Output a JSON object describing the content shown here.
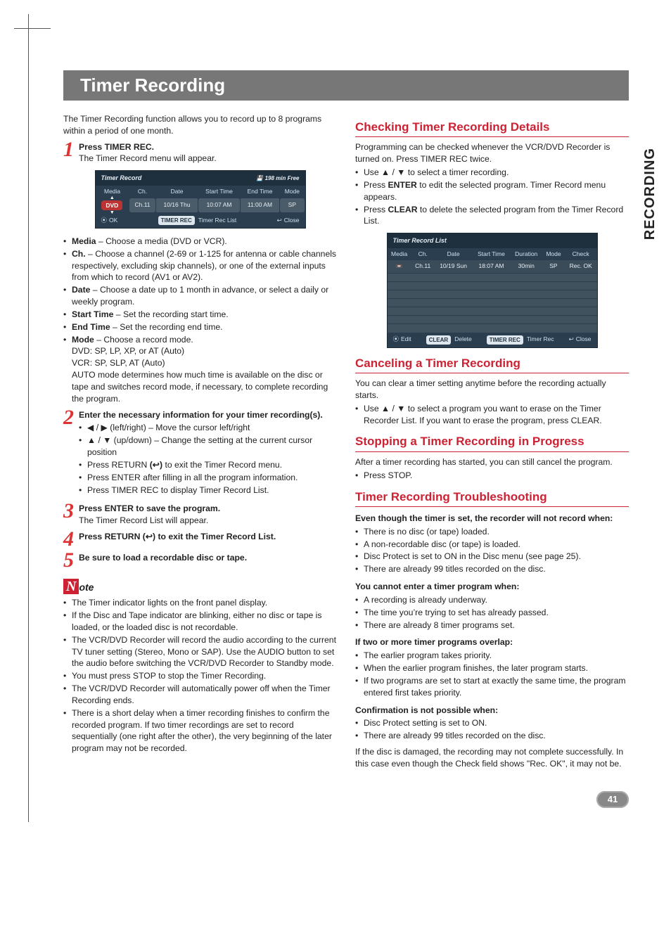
{
  "side_tab": "RECORDING",
  "page_title": "Timer Recording",
  "intro": "The Timer Recording function allows you to record up to 8 programs within a period of one month.",
  "steps": {
    "s1_lead": "Press TIMER REC.",
    "s1_sub": "The Timer Record menu will appear.",
    "s2_lead": "Enter the necessary information for your timer recording(s).",
    "s3_lead": "Press ENTER to save the program.",
    "s3_sub": "The Timer Record List will appear.",
    "s4_lead": "Press RETURN (↩) to exit the Timer Record List.",
    "s5_lead": "Be sure to load a recordable disc or tape."
  },
  "osd1": {
    "title": "Timer Record",
    "free": "198  min Free",
    "cols": [
      "Media",
      "Ch.",
      "Date",
      "Start Time",
      "End Time",
      "Mode"
    ],
    "row": {
      "media": "DVD",
      "ch": "Ch.11",
      "date": "10/16 Thu",
      "start": "10:07 AM",
      "end": "11:00 AM",
      "mode": "SP"
    },
    "footer": {
      "ok": "OK",
      "mid_btn": "TIMER REC",
      "mid_label": "Timer Rec List",
      "close": "Close"
    }
  },
  "fields": {
    "media_b": "Media",
    "media_t": " – Choose a media (DVD or VCR).",
    "ch_b": "Ch.",
    "ch_t": " – Choose a channel (2-69 or 1-125 for antenna or cable channels respectively, excluding skip channels), or one of the external inputs from which to record (AV1 or AV2).",
    "date_b": "Date",
    "date_t": " – Choose a date up to 1 month in advance, or select a daily or weekly program.",
    "start_b": "Start Time",
    "start_t": " – Set the recording start time.",
    "end_b": "End Time",
    "end_t": " – Set the recording end time.",
    "mode_b": "Mode",
    "mode_t": " – Choose a record mode.",
    "mode_l1": "DVD: SP, LP, XP, or AT (Auto)",
    "mode_l2": "VCR: SP, SLP, AT (Auto)",
    "mode_l3": "AUTO mode determines how much time is available on the disc or tape and switches record mode, if necessary, to complete recording the program."
  },
  "step2_bullets": {
    "b1": "◀ / ▶ (left/right) – Move the cursor left/right",
    "b2": "▲ / ▼ (up/down) – Change the setting at the current cursor position",
    "b3a": "Press RETURN ",
    "b3b": "(↩)",
    "b3c": " to exit the Timer Record menu.",
    "b4": "Press ENTER after filling in all the program information.",
    "b5": "Press TIMER REC to display Timer Record List."
  },
  "note_label_rest": "ote",
  "notes": [
    "The Timer indicator lights on the front panel display.",
    "If the Disc and Tape indicator are blinking, either no disc or tape is loaded, or the loaded disc is not recordable.",
    "The VCR/DVD Recorder will record the audio according to the current TV tuner setting (Stereo, Mono or SAP). Use the AUDIO button to set the audio before switching the VCR/DVD Recorder to Standby mode.",
    "You must press STOP to stop the Timer Recording.",
    "The VCR/DVD Recorder will automatically power off when the Timer Recording ends.",
    "There is a short delay when a timer recording finishes to confirm the recorded program. If two timer recordings are set to record sequentially (one right after the other), the very beginning of the later program may not be recorded."
  ],
  "right": {
    "h_check": "Checking Timer Recording Details",
    "check_intro": "Programming can be checked whenever the VCR/DVD Recorder is turned on. Press TIMER REC twice.",
    "check_b1": "Use ▲ / ▼ to select a timer recording.",
    "check_b2a": "Press ",
    "check_b2b": "ENTER",
    "check_b2c": " to edit the selected program. Timer Record menu appears.",
    "check_b3a": "Press ",
    "check_b3b": "CLEAR",
    "check_b3c": " to delete the selected program from the Timer Record List.",
    "osd2": {
      "title": "Timer Record List",
      "cols": [
        "Media",
        "Ch.",
        "Date",
        "Start Time",
        "Duration",
        "Mode",
        "Check"
      ],
      "row": {
        "media_icon": "📼",
        "ch": "Ch.11",
        "date": "10/19 Sun",
        "start": "18:07 AM",
        "dur": "30min",
        "mode": "SP",
        "check": "Rec. OK"
      },
      "footer": {
        "edit": "Edit",
        "del_btn": "CLEAR",
        "del_label": "Delete",
        "mid_btn": "TIMER REC",
        "mid_label": "Timer Rec",
        "close": "Close"
      }
    },
    "h_cancel": "Canceling a Timer Recording",
    "cancel_intro": "You can clear a timer setting anytime before the recording actually starts.",
    "cancel_b1": "Use ▲ / ▼ to select a program you want to erase on the Timer Recorder List. If you want to erase the program, press CLEAR.",
    "h_stop": "Stopping a Timer Recording in Progress",
    "stop_intro": "After a timer recording has started, you can still cancel the program.",
    "stop_b1": "Press STOP.",
    "h_trouble": "Timer Recording Troubleshooting",
    "t1_h": "Even though the timer is set, the recorder will not record when:",
    "t1": [
      "There is no disc (or tape) loaded.",
      "A non-recordable disc (or tape) is loaded.",
      "Disc Protect is set to ON in the Disc menu (see page 25).",
      "There are already 99 titles recorded on the disc."
    ],
    "t2_h": "You cannot enter a timer program when:",
    "t2": [
      "A recording is already underway.",
      "The time you’re trying to set has already passed.",
      "There are already 8 timer programs set."
    ],
    "t3_h": "If two or more timer programs overlap:",
    "t3": [
      "The earlier program takes priority.",
      "When the earlier program finishes, the later program starts.",
      "If two programs are set to start at exactly the same time, the program entered first takes priority."
    ],
    "t4_h": "Confirmation is not possible when:",
    "t4": [
      "Disc Protect setting is set to ON.",
      "There are already 99 titles recorded on the disc."
    ],
    "tail": "If the disc is damaged, the recording may not complete successfully. In this case even though the Check field shows \"Rec. OK\", it may not be."
  },
  "page_number": "41"
}
